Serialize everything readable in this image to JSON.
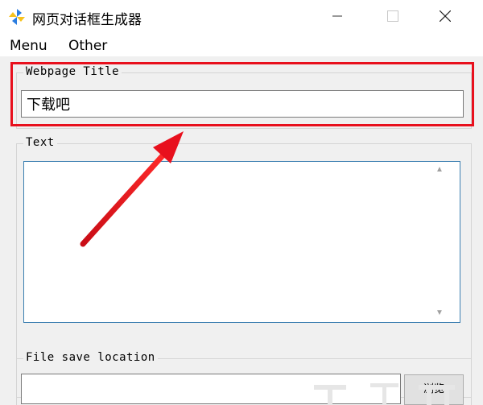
{
  "window": {
    "title": "网页对话框生成器",
    "icon": "pinwheel-icon"
  },
  "menu": {
    "items": [
      {
        "label": "Menu"
      },
      {
        "label": "Other"
      }
    ]
  },
  "groups": {
    "webpage_title": {
      "legend": "Webpage Title",
      "value": "下载吧"
    },
    "text": {
      "legend": "Text",
      "value": ""
    },
    "file_save_location": {
      "legend": "File save location",
      "value": "",
      "browse_label": "浏览"
    }
  },
  "colors": {
    "highlight": "#e8101d",
    "text_border": "#3c7fb1"
  }
}
